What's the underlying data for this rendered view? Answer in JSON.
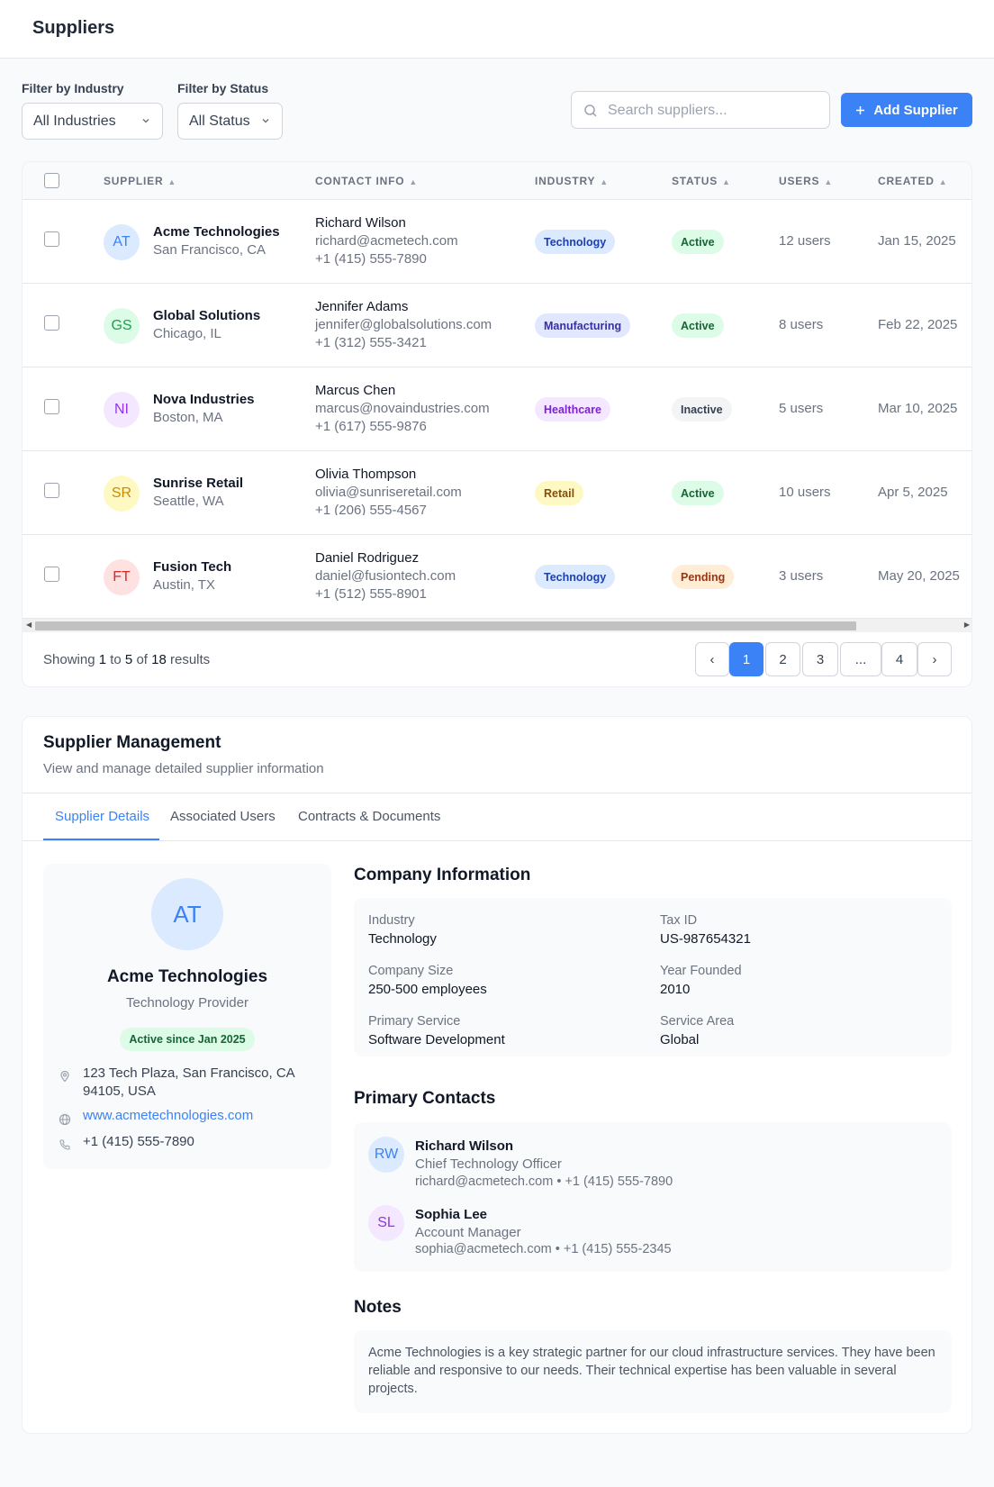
{
  "header": {
    "title": "Suppliers"
  },
  "filters": {
    "industry_label": "Filter by Industry",
    "industry_value": "All Industries",
    "status_label": "Filter by Status",
    "status_value": "All Status"
  },
  "search": {
    "placeholder": "Search suppliers..."
  },
  "add_button": {
    "label": "Add Supplier"
  },
  "table": {
    "columns": [
      "SUPPLIER",
      "CONTACT INFO",
      "INDUSTRY",
      "STATUS",
      "USERS",
      "CREATED"
    ],
    "rows": [
      {
        "initials": "AT",
        "name": "Acme Technologies",
        "location": "San Francisco, CA",
        "contact": "Richard Wilson",
        "email": "richard@acmetech.com",
        "phone": "+1 (415) 555-7890",
        "industry": "Technology",
        "status": "Active",
        "users": "12 users",
        "created": "Jan 15, 2025"
      },
      {
        "initials": "GS",
        "name": "Global Solutions",
        "location": "Chicago, IL",
        "contact": "Jennifer Adams",
        "email": "jennifer@globalsolutions.com",
        "phone": "+1 (312) 555-3421",
        "industry": "Manufacturing",
        "status": "Active",
        "users": "8 users",
        "created": "Feb 22, 2025"
      },
      {
        "initials": "NI",
        "name": "Nova Industries",
        "location": "Boston, MA",
        "contact": "Marcus Chen",
        "email": "marcus@novaindustries.com",
        "phone": "+1 (617) 555-9876",
        "industry": "Healthcare",
        "status": "Inactive",
        "users": "5 users",
        "created": "Mar 10, 2025"
      },
      {
        "initials": "SR",
        "name": "Sunrise Retail",
        "location": "Seattle, WA",
        "contact": "Olivia Thompson",
        "email": "olivia@sunriseretail.com",
        "phone": "+1 (206) 555-4567",
        "industry": "Retail",
        "status": "Active",
        "users": "10 users",
        "created": "Apr 5, 2025"
      },
      {
        "initials": "FT",
        "name": "Fusion Tech",
        "location": "Austin, TX",
        "contact": "Daniel Rodriguez",
        "email": "daniel@fusiontech.com",
        "phone": "+1 (512) 555-8901",
        "industry": "Technology",
        "status": "Pending",
        "users": "3 users",
        "created": "May 20, 2025"
      }
    ]
  },
  "pagination": {
    "showing_prefix": "Showing",
    "from": "1",
    "to_word": "to",
    "to": "5",
    "of_word": "of",
    "total": "18",
    "results_word": "results",
    "prev": "‹",
    "pages": [
      "1",
      "2",
      "3",
      "...",
      "4"
    ],
    "next": "›"
  },
  "management": {
    "title": "Supplier Management",
    "subtitle": "View and manage detailed supplier information",
    "tabs": [
      "Supplier Details",
      "Associated Users",
      "Contracts & Documents"
    ],
    "profile": {
      "initials": "AT",
      "name": "Acme Technologies",
      "type": "Technology Provider",
      "since": "Active since Jan 2025",
      "address_line1": "123 Tech Plaza, San Francisco, CA",
      "address_line2": "94105, USA",
      "website": "www.acmetechnologies.com",
      "phone": "+1 (415) 555-7890"
    },
    "company_info_title": "Company Information",
    "company_info": [
      {
        "label": "Industry",
        "value": "Technology"
      },
      {
        "label": "Tax ID",
        "value": "US-987654321"
      },
      {
        "label": "Company Size",
        "value": "250-500 employees"
      },
      {
        "label": "Year Founded",
        "value": "2010"
      },
      {
        "label": "Primary Service",
        "value": "Software Development"
      },
      {
        "label": "Service Area",
        "value": "Global"
      }
    ],
    "contacts_title": "Primary Contacts",
    "contacts": [
      {
        "initials": "RW",
        "name": "Richard Wilson",
        "role": "Chief Technology Officer",
        "info": "richard@acmetech.com • +1 (415) 555-7890"
      },
      {
        "initials": "SL",
        "name": "Sophia Lee",
        "role": "Account Manager",
        "info": "sophia@acmetech.com • +1 (415) 555-2345"
      }
    ],
    "notes_title": "Notes",
    "notes": "Acme Technologies is a key strategic partner for our cloud infrastructure services. They have been reliable and responsive to our needs. Their technical expertise has been valuable in several projects."
  },
  "colors": {
    "accent": "#3b82f6",
    "badge_technology_bg": "#dbeafe",
    "badge_manufacturing_bg": "#e0e7ff",
    "badge_healthcare_bg": "#f3e8ff",
    "badge_retail_bg": "#fef9c3",
    "status_active_bg": "#dcfce7",
    "status_inactive_bg": "#f3f4f6",
    "status_pending_bg": "#ffedd5"
  },
  "icons": [
    "search-icon",
    "chevron-down-icon",
    "plus-icon",
    "sort-icon",
    "map-pin-icon",
    "globe-icon",
    "phone-icon"
  ]
}
